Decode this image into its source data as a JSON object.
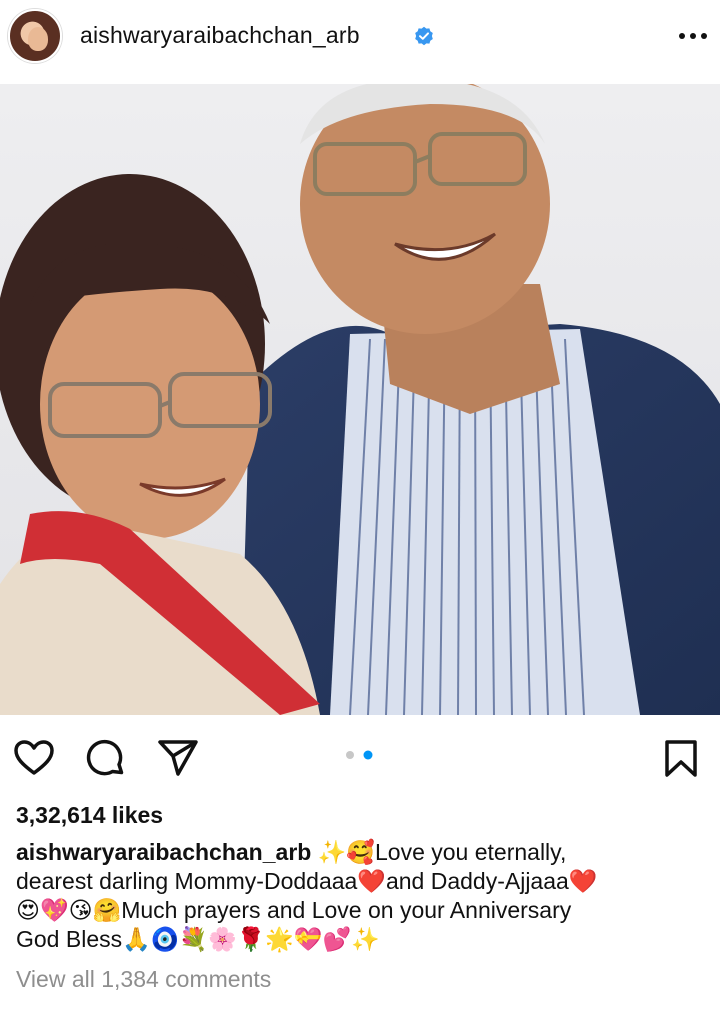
{
  "post": {
    "username": "aishwaryaraibachchan_arb",
    "verified": true,
    "likes_text": "3,32,614 likes",
    "caption_lines": [
      "✨🥰Love you eternally,",
      "dearest darling Mommy-Doddaaa❤️and Daddy-Ajjaaa❤️",
      "😍💖😘🤗Much prayers and Love on your Anniversary",
      "God Bless🙏🧿💐🌸🌹🌟💝💕✨"
    ],
    "view_comments_text": "View all 1,384 comments",
    "carousel": {
      "total": 2,
      "active": 2
    }
  },
  "icons": {
    "verified": "verified-badge-icon",
    "more": "more-options-icon",
    "like": "heart-icon",
    "comment": "comment-bubble-icon",
    "share": "paper-plane-icon",
    "save": "bookmark-icon"
  },
  "colors": {
    "verified_blue": "#3897f0",
    "carousel_active": "#0095f6",
    "carousel_inactive": "#c7c7c7",
    "muted_text": "#8e8e8e"
  }
}
